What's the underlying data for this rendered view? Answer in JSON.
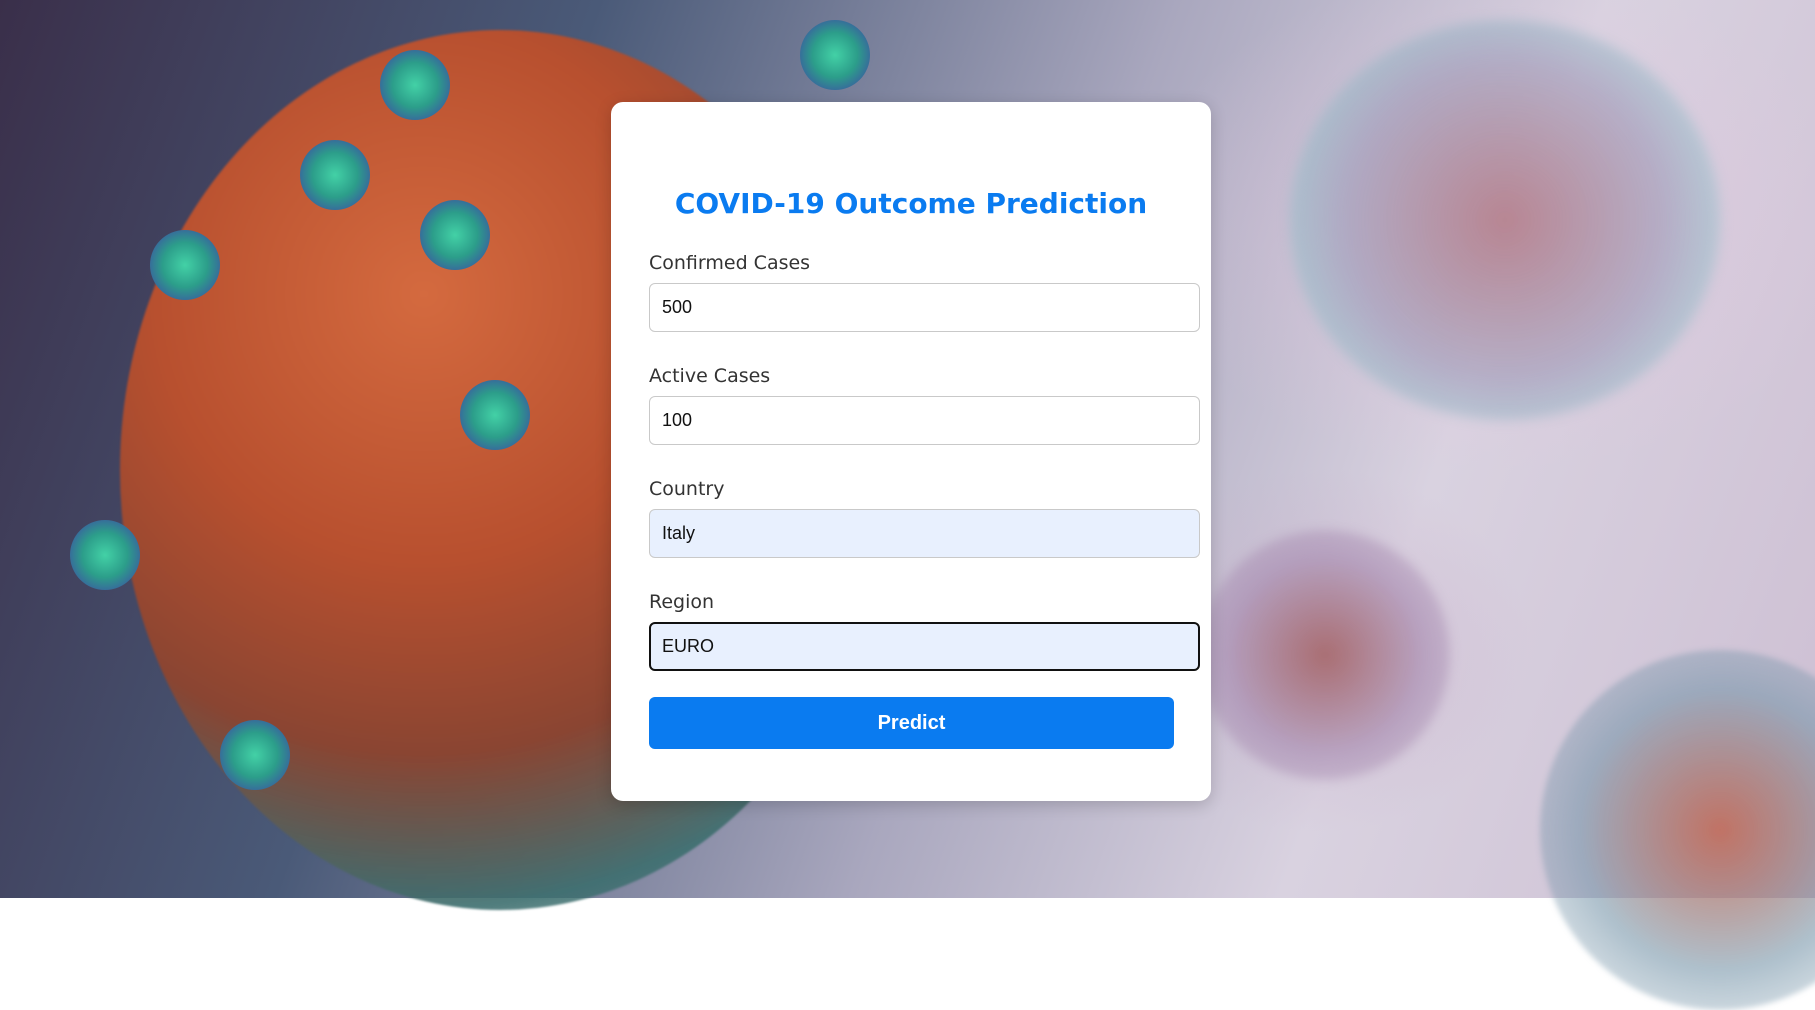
{
  "form": {
    "title": "COVID-19 Outcome Prediction",
    "fields": [
      {
        "label": "Confirmed Cases",
        "value": "500"
      },
      {
        "label": "Active Cases",
        "value": "100"
      },
      {
        "label": "Country",
        "value": "Italy"
      },
      {
        "label": "Region",
        "value": "EURO"
      }
    ],
    "submit_label": "Predict"
  },
  "colors": {
    "accent": "#0a7bf0",
    "card_background": "#ffffff",
    "autofill_background": "#e8f0fe"
  },
  "background": {
    "icon": "coronavirus-illustration"
  }
}
